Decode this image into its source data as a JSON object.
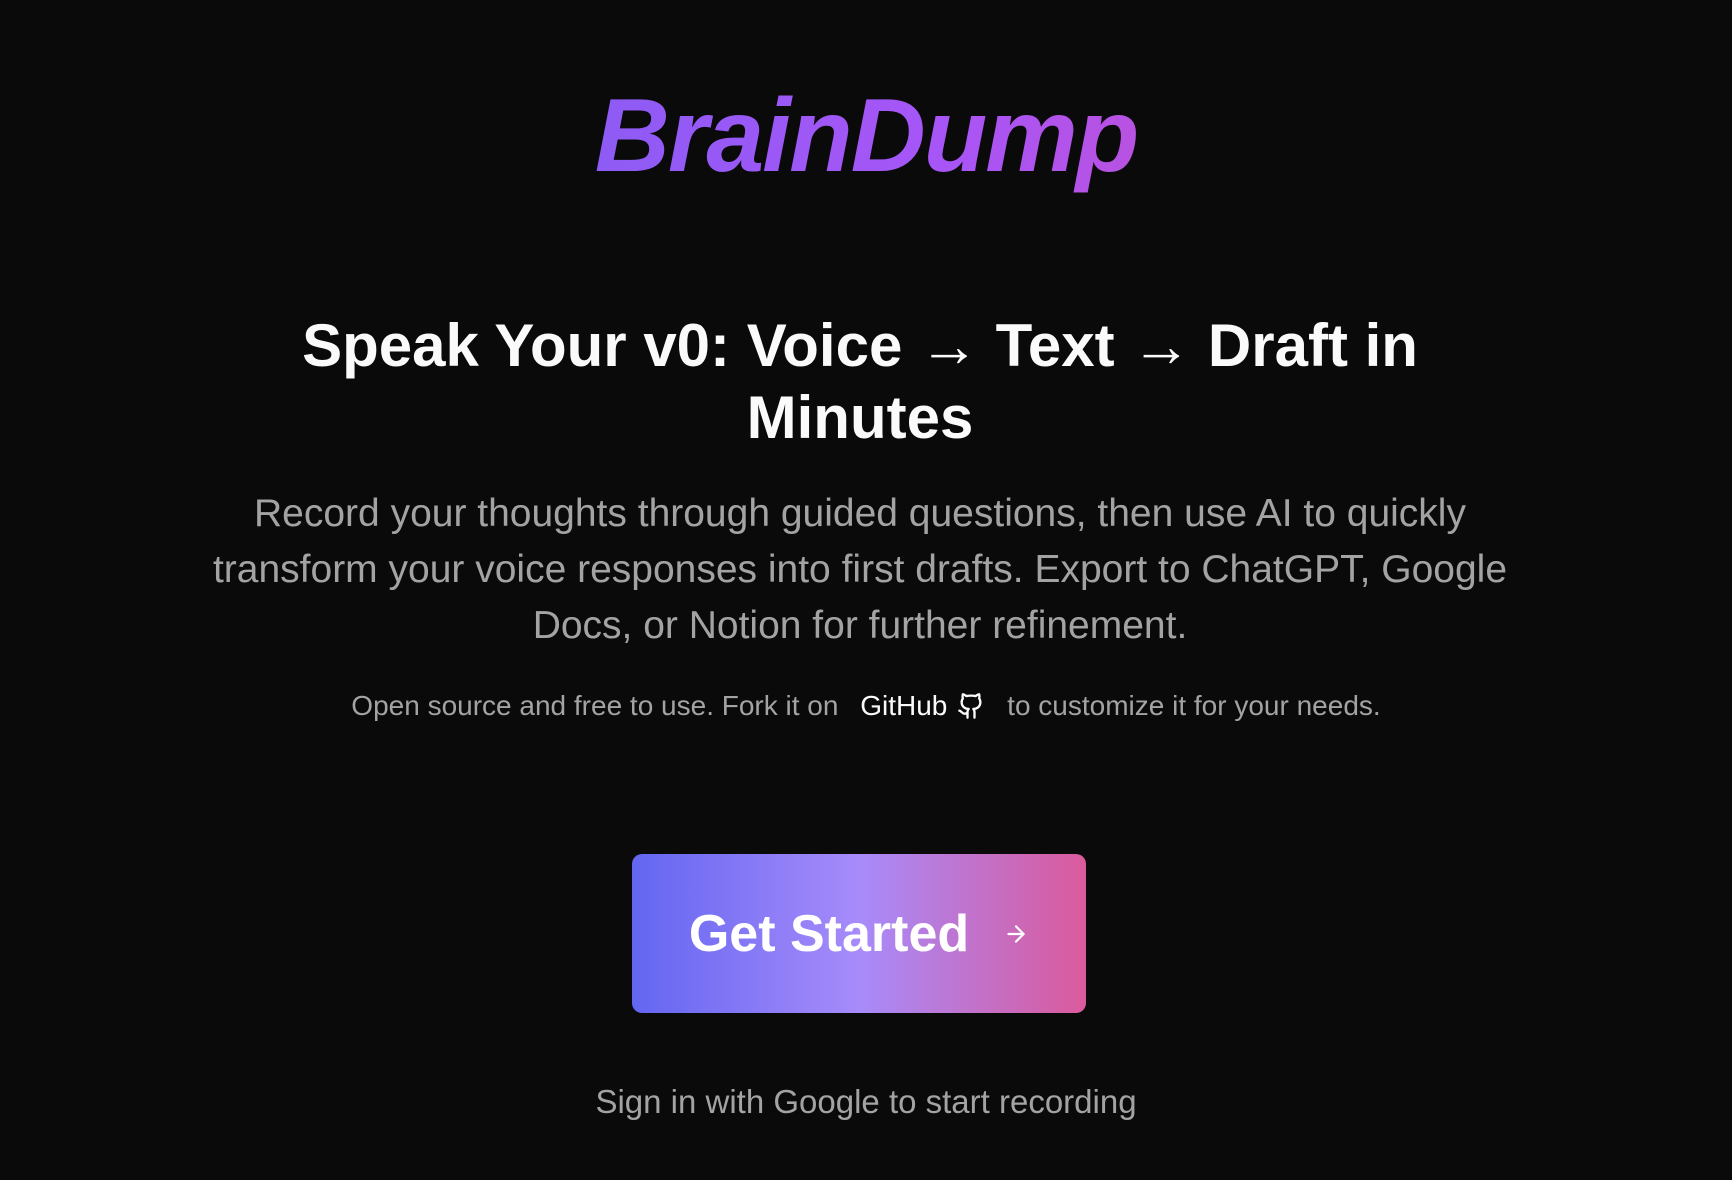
{
  "brand": {
    "logo_text": "BrainDump",
    "gradient_colors": [
      "#6366f1",
      "#a855f7",
      "#ec4899"
    ]
  },
  "hero": {
    "headline": "Speak Your v0: Voice → Text → Draft in Minutes",
    "description": "Record your thoughts through guided questions, then use AI to quickly transform your voice responses into first drafts. Export to ChatGPT, Google Docs, or Notion for further refinement."
  },
  "open_source": {
    "prefix": "Open source and free to use. Fork it on",
    "link_label": "GitHub",
    "link_icon": "github-icon",
    "suffix": "to customize it for your needs."
  },
  "cta": {
    "label": "Get Started",
    "icon": "arrow-right-icon",
    "gradient_colors": [
      "#6366f1",
      "#a78bfa",
      "#db5a9c"
    ]
  },
  "signin_hint": "Sign in with Google to start recording",
  "colors": {
    "background": "#0a0a0a",
    "heading": "#fafafa",
    "muted": "#a3a3a3"
  }
}
